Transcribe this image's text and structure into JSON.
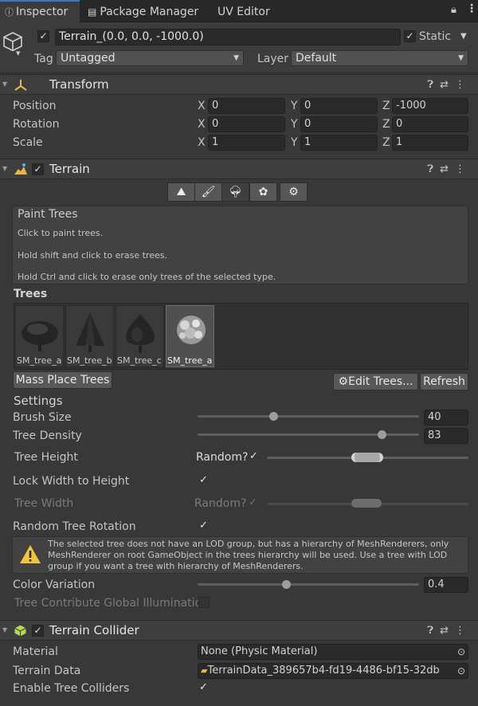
{
  "tabs": [
    {
      "label": "Inspector",
      "active": true
    },
    {
      "label": "Package Manager",
      "active": false
    },
    {
      "label": "UV Editor",
      "active": false
    }
  ],
  "object": {
    "name": "Terrain_(0.0, 0.0, -1000.0)",
    "static_label": "Static",
    "tag_label": "Tag",
    "tag_value": "Untagged",
    "layer_label": "Layer",
    "layer_value": "Default"
  },
  "transform": {
    "title": "Transform",
    "rows": [
      {
        "label": "Position",
        "x": "0",
        "y": "0",
        "z": "-1000"
      },
      {
        "label": "Rotation",
        "x": "0",
        "y": "0",
        "z": "0"
      },
      {
        "label": "Scale",
        "x": "1",
        "y": "1",
        "z": "1"
      }
    ]
  },
  "terrain": {
    "title": "Terrain",
    "tools": [
      "raise-terrain-icon",
      "paint-brush-icon",
      "paint-trees-icon",
      "paint-details-icon",
      "settings-gear-icon"
    ],
    "active_tool": 2,
    "help_title": "Paint Trees",
    "help_lines": [
      "Click to paint trees.",
      "Hold shift and click to erase trees.",
      "Hold Ctrl and click to erase only trees of the selected type."
    ],
    "trees_label": "Trees",
    "trees": [
      "SM_tree_a",
      "SM_tree_b",
      "SM_tree_c",
      "SM_tree_a"
    ],
    "selected_tree": 3,
    "mass_place_button": "Mass Place Trees",
    "edit_trees_button": "Edit Trees...",
    "refresh_button": "Refresh",
    "settings_label": "Settings",
    "brush_size_label": "Brush Size",
    "brush_size": "40",
    "brush_size_fraction": 0.34,
    "tree_density_label": "Tree Density",
    "tree_density": "83",
    "tree_density_fraction": 0.83,
    "tree_height_label": "Tree Height",
    "random_label": "Random?",
    "lock_width_label": "Lock Width to Height",
    "tree_width_label": "Tree Width",
    "random_rotation_label": "Random Tree Rotation",
    "warning": "The selected tree does not have an LOD group, but has a hierarchy of MeshRenderers, only MeshRenderer on root GameObject in the trees hierarchy will be used. Use a tree with LOD group if you want a tree with hierarchy of MeshRenderers.",
    "color_variation_label": "Color Variation",
    "color_variation": "0.4",
    "color_variation_fraction": 0.4,
    "gi_label": "Tree Contribute Global Illumination"
  },
  "collider": {
    "title": "Terrain Collider",
    "material_label": "Material",
    "material_value": "None (Physic Material)",
    "terrain_data_label": "Terrain Data",
    "terrain_data_value": "TerrainData_389657b4-fd19-4486-bf15-32db",
    "enable_colliders_label": "Enable Tree Colliders"
  },
  "colors": {
    "background": "#383838",
    "accent": "#3a79bb",
    "warning_yellow": "#f2c43d"
  }
}
